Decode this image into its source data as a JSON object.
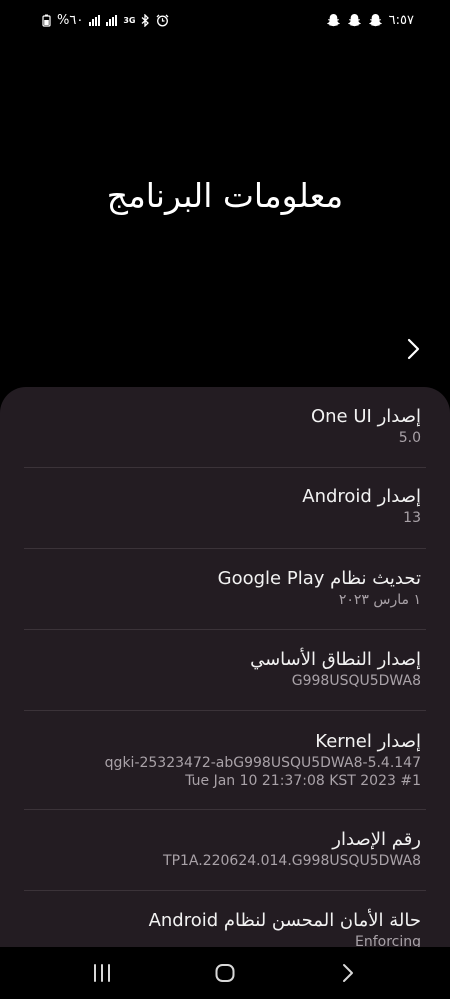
{
  "status_bar": {
    "battery_percent": "%٦٠",
    "network_label": "3G",
    "time": "٦:٥٧",
    "icons": [
      "battery-saver-icon",
      "signal-icon",
      "signal-icon",
      "bluetooth-icon",
      "alarm-icon",
      "snapchat-icon",
      "snapchat-icon",
      "snapchat-icon"
    ]
  },
  "header": {
    "title": "معلومات البرنامج"
  },
  "items": [
    {
      "title": "إصدار One UI",
      "value": "5.0"
    },
    {
      "title": "إصدار Android",
      "value": "13"
    },
    {
      "title": "تحديث نظام Google Play",
      "value": "١ مارس ٢٠٢٣"
    },
    {
      "title": "إصدار النطاق الأساسي",
      "value": "G998USQU5DWA8"
    },
    {
      "title": "إصدار Kernel",
      "value": "5.4.147-qgki-25323472-abG998USQU5DWA8",
      "value2": "#1 Tue Jan 10 21:37:08 KST 2023"
    },
    {
      "title": "رقم الإصدار",
      "value": "TP1A.220624.014.G998USQU5DWA8"
    },
    {
      "title": "حالة الأمان المحسن لنظام Android",
      "value": "Enforcing"
    }
  ],
  "nav": {
    "recents": "recents-icon",
    "home": "home-icon",
    "back": "back-icon"
  }
}
